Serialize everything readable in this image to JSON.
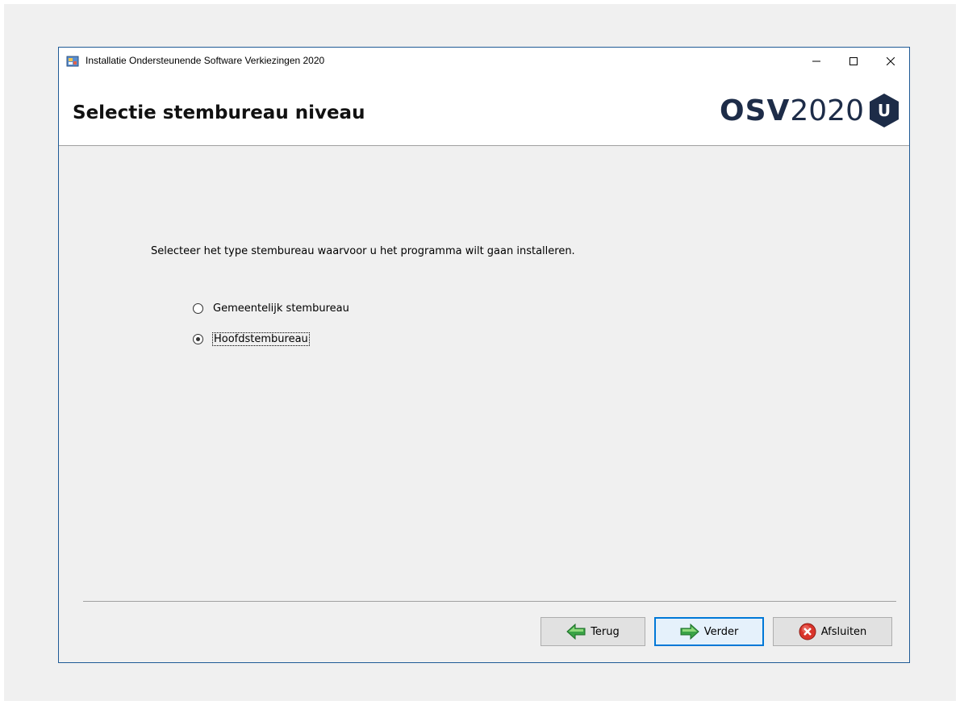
{
  "window": {
    "title": "Installatie Ondersteunende Software Verkiezingen 2020"
  },
  "header": {
    "title": "Selectie stembureau niveau",
    "logo_bold": "OSV",
    "logo_light": "2020",
    "logo_badge": "U"
  },
  "main": {
    "instruction": "Selecteer het type stembureau waarvoor u het programma wilt gaan installeren.",
    "options": [
      {
        "label": "Gemeentelijk stembureau",
        "selected": false
      },
      {
        "label": "Hoofdstembureau",
        "selected": true
      }
    ]
  },
  "footer": {
    "back_label": "Terug",
    "next_label": "Verder",
    "exit_label": "Afsluiten"
  },
  "colors": {
    "brand": "#1d2c48",
    "nav_arrow": "#3aa346",
    "exit_red": "#d9342b",
    "focus_blue": "#0078d7"
  },
  "icons": {
    "app": "installer-icon",
    "back": "arrow-left-icon",
    "next": "arrow-right-icon",
    "exit": "close-circle-icon"
  }
}
